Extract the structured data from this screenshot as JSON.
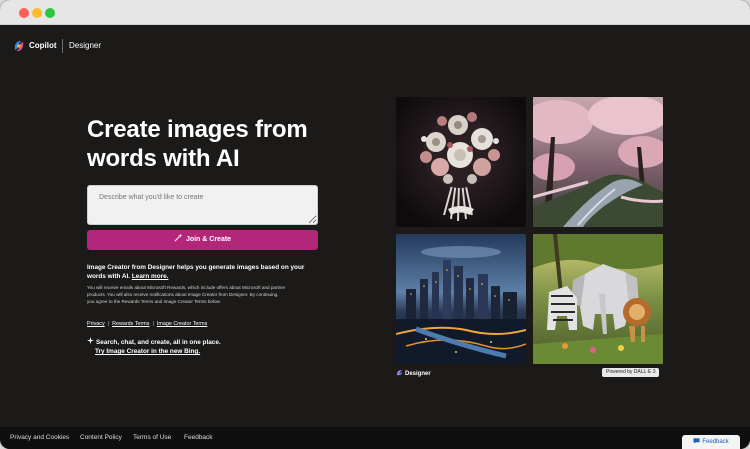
{
  "brand": {
    "name": "Copilot",
    "product": "Designer"
  },
  "hero": {
    "title": "Create images from words with AI",
    "prompt_placeholder": "Describe what you'd like to create",
    "join_label": "Join & Create",
    "intro_text": "Image Creator from Designer helps you generate images based on your words with AI.",
    "intro_link": "Learn more.",
    "disclaimer": "You will receive emails about Microsoft Rewards, which include offers about Microsoft and partner products. You will also receive notifications about Image Creator from Designer. By continuing, you agree to the Rewards Terms and Image Creator Terms below.",
    "terms_links": [
      "Privacy",
      "Rewards Terms",
      "Image Creator Terms"
    ],
    "promo_line1": "Search, chat, and create, all in one place.",
    "promo_line2": "Try Image Creator in the new Bing."
  },
  "gallery": {
    "caption": "Designer",
    "badge": "Powered by DALL·E 3",
    "tiles": [
      {
        "subject": "flower-bouquet"
      },
      {
        "subject": "cherry-blossom-river"
      },
      {
        "subject": "city-skyline"
      },
      {
        "subject": "origami-animals"
      }
    ]
  },
  "footer": {
    "links": [
      "Privacy and Cookies",
      "Content Policy",
      "Terms of Use",
      "Feedback"
    ],
    "feedback_tab": "Feedback"
  },
  "colors": {
    "background": "#1b1a19",
    "accent": "#b3277a",
    "footer": "#0f0f0f"
  }
}
